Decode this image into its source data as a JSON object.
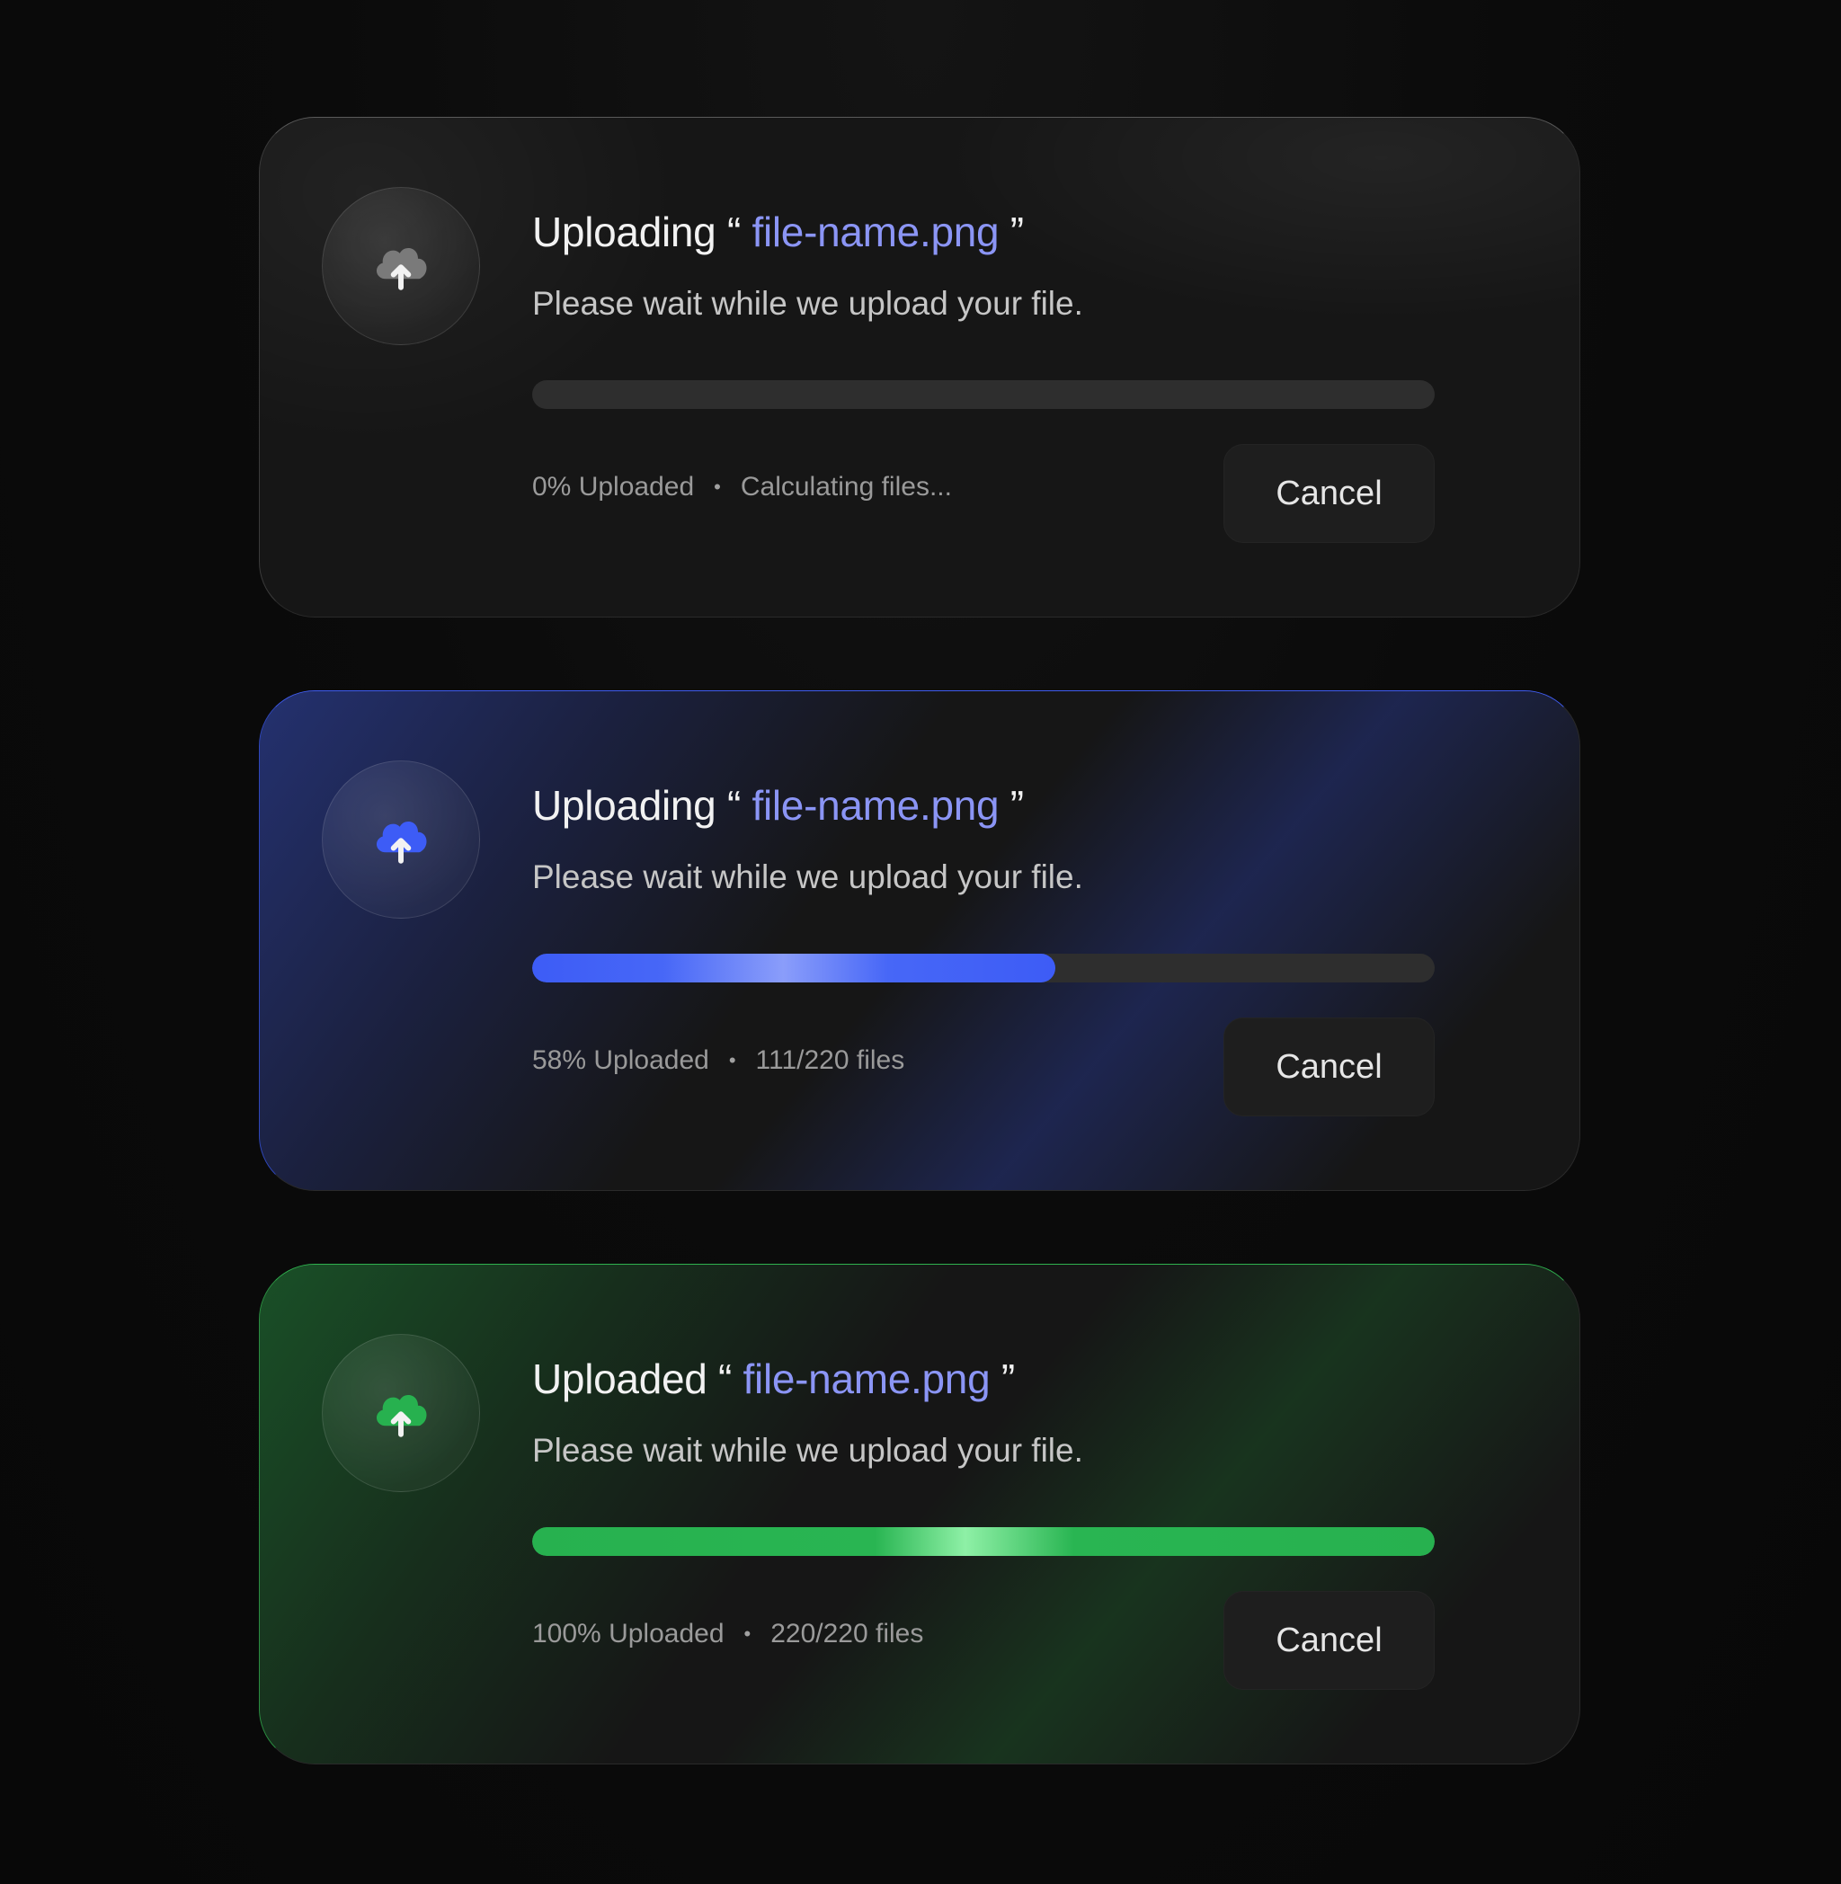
{
  "colors": {
    "background": "#0b0b0b",
    "card": "#161616",
    "file_name": "#8b95f5",
    "neutral_icon": "#7a7a7a",
    "blue_accent": "#3d5cf6",
    "green_accent": "#27b14f"
  },
  "cards": [
    {
      "state": "neutral",
      "icon": "cloud-upload-icon",
      "title_prefix": "Uploading",
      "open_quote": "“",
      "file_name": "file-name.png",
      "close_quote": "”",
      "subtitle": "Please wait while we upload your file.",
      "progress": 0,
      "percent_label": "0% Uploaded",
      "separator": "•",
      "files_label": "Calculating files...",
      "cancel_label": "Cancel"
    },
    {
      "state": "blue",
      "icon": "cloud-upload-icon",
      "title_prefix": "Uploading",
      "open_quote": "“",
      "file_name": "file-name.png",
      "close_quote": "”",
      "subtitle": "Please wait while we upload your file.",
      "progress": 0.58,
      "percent_label": "58% Uploaded",
      "separator": "•",
      "files_label": "111/220 files",
      "cancel_label": "Cancel"
    },
    {
      "state": "green",
      "icon": "cloud-upload-icon",
      "title_prefix": "Uploaded",
      "open_quote": "“",
      "file_name": "file-name.png",
      "close_quote": "”",
      "subtitle": "Please wait while we upload your file.",
      "progress": 1.0,
      "percent_label": "100% Uploaded",
      "separator": "•",
      "files_label": "220/220 files",
      "cancel_label": "Cancel"
    }
  ]
}
